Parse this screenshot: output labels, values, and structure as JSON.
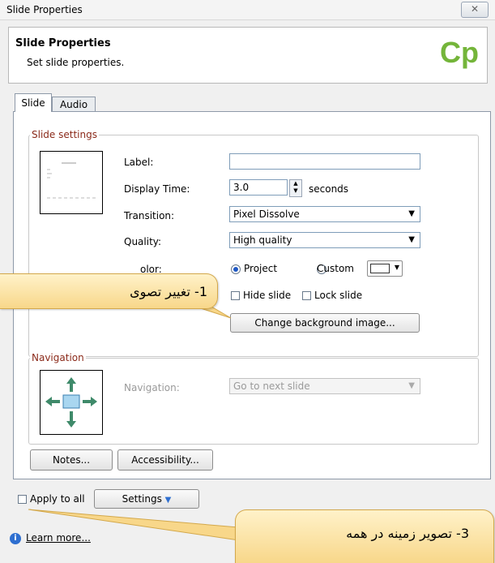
{
  "window": {
    "title": "Slide Properties",
    "close_glyph": "✕"
  },
  "header": {
    "title": "Slide Properties",
    "subtitle": "Set slide properties.",
    "logo_text": "Cp"
  },
  "tabs": [
    {
      "label": "Slide",
      "active": true
    },
    {
      "label": "Audio",
      "active": false
    }
  ],
  "slide_settings": {
    "group_title": "Slide settings",
    "label_label": "Label:",
    "label_value": "",
    "display_time_label": "Display Time:",
    "display_time_value": "3.0",
    "display_time_unit": "seconds",
    "transition_label": "Transition:",
    "transition_value": "Pixel Dissolve",
    "quality_label": "Quality:",
    "quality_value": "High quality",
    "color_label_partial": "olor:",
    "color_project_label": "Project",
    "color_custom_label": "Custom",
    "hide_slide_label": "Hide slide",
    "lock_slide_label": "Lock slide",
    "change_bg_button": "Change background image..."
  },
  "navigation": {
    "group_title": "Navigation",
    "label": "Navigation:",
    "value": "Go to next slide"
  },
  "buttons": {
    "notes": "Notes...",
    "accessibility": "Accessibility..."
  },
  "footer": {
    "apply_to_all": "Apply to all",
    "settings": "Settings",
    "learn_more": "Learn more..."
  },
  "callouts": {
    "one": "1- تغییر تصوی",
    "three": "3- تصویر زمینه در همه"
  },
  "colors": {
    "accent_red": "#8b2a1a",
    "logo_green": "#74b53a",
    "callout_fill": "#f8d78a"
  }
}
